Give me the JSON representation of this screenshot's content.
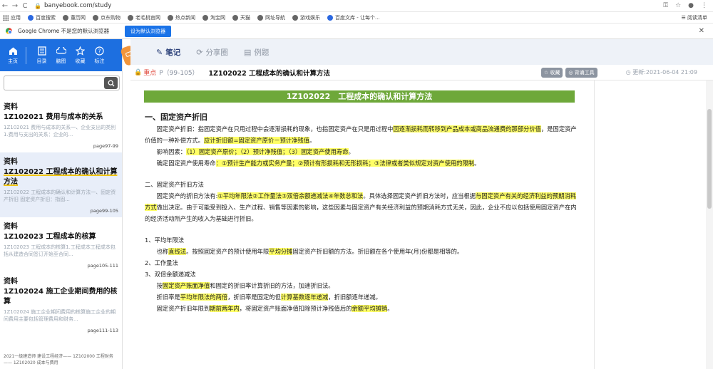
{
  "browser": {
    "url": "banyebook.com/study",
    "bookmarks": [
      "应用",
      "百度搜索",
      "董历网",
      "京东购物",
      "老毛桃官网",
      "热点新闻",
      "淘宝网",
      "天猫",
      "网址导航",
      "游戏娱乐",
      "百度文库 - 让每个..."
    ],
    "reading_list": "阅读清单",
    "infobar_text": "Google Chrome 不是您的默认浏览器",
    "infobar_button": "设为默认浏览器"
  },
  "sidebar": {
    "nav": [
      "主页",
      "目录",
      "脑图",
      "收藏",
      "标注"
    ],
    "search_placeholder": "",
    "cards": [
      {
        "category": "资料",
        "title": "1Z102021 费用与成本的关系",
        "snippet": "1Z102021 费用与成本的关系一、企业支出的类别1.费用与支出的关系：企业的...",
        "pages": "page97-99"
      },
      {
        "category": "资料",
        "title": "1Z102022 工程成本的确认和计算方法",
        "snippet": "1Z102022 工程成本的确认和计算方法一、固定资产折旧 固定资产折旧：指固...",
        "pages": "page99-105"
      },
      {
        "category": "资料",
        "title": "1Z102023 工程成本的核算",
        "snippet": "1Z102023 工程成本的核算1.工程成本工程成本包括从建造合同签订开始至合同...",
        "pages": "page105-111"
      },
      {
        "category": "资料",
        "title": "1Z102024 施工企业期间费用的核算",
        "snippet": "1Z102024 施工企业期间费用的核算施工企业的期间费用主要包括管理费用和财务...",
        "pages": "page111-113"
      }
    ],
    "footer": "2021一级建造师 建设工程经济—— 1Z102000 工程财务 —— 1Z102020 成本与费用"
  },
  "main": {
    "tabs": [
      "笔记",
      "分享圈",
      "例题"
    ],
    "key_label": "重点",
    "page_range": "P（99-105）",
    "title": "1Z102022 工程成本的确认和计算方法",
    "fav_button": "收藏",
    "tool_button": "背诵工具",
    "updated": "更新:2021-06-04 21:09"
  },
  "doc": {
    "banner": "1Z102022　工程成本的确认和计算方法",
    "s1_heading": "一、固定资产折旧",
    "p1a": "固定资产折旧：指固定资产在只用过程中会逐渐损耗的现象，也指固定资产在只是用过程中",
    "p1b": "因逐渐损耗而转移到产品成本或商品流通费的那部分价值",
    "p1c": "，是固定资产价值的一种补偿方式。",
    "p1d": "应计折旧额=固定资产原价－预计净残值",
    "p1e": "。",
    "p2a": "影响因素：",
    "p2b": "（1）固定资产原价；（2）预计净残值；（3）固定资产使用寿命",
    "p2c": "。",
    "p3a": "确定固定资产使用寿命",
    "p3b": "：①预计生产能力或实务产量；②预计有形损耗和无形损耗；③法律或者类似规定对资产使用的限制",
    "p3c": "。",
    "s2_heading": "二、固定资产折旧方法",
    "p4a": "固定资产的折旧方法有:",
    "p4b": "①平均年限法②工作量法③双倍余额递减法④年数总和法",
    "p4c": "。具体选择固定资产折旧方法时，应当根据",
    "p4d": "与固定资产有关的经济利益的预期消耗方式",
    "p4e": "做出决定。由于可能受到投入、生产过程、销售等因素的影响，这些因素与固定资产有关经济利益的预期消耗方式无关，因此，企业不应以包括使用固定资产在内的经济活动所产生的收入为基础进行折旧。",
    "m1": "1、平均年限法",
    "m1a": "也称",
    "m1b": "直线法",
    "m1c": "。按照固定资产的预计使用年限",
    "m1d": "平均分摊",
    "m1e": "固定资产折旧额的方法。折旧额在各个使用年(月)份都是相等的。",
    "m2": "2、工作量法",
    "m3": "3、双倍余额递减法",
    "m3a": "按",
    "m3b": "固定资产账面净值",
    "m3c": "和固定的折旧率计算折旧的方法，加速折旧法。",
    "m3d": "折旧率是",
    "m3e": "平均年限法的两倍",
    "m3f": "，折旧率是固定的但",
    "m3g": "计算基数逐年递减",
    "m3h": "，折旧额逐年递减。",
    "m3i": "固定资产折旧年限到",
    "m3j": "期前两年内",
    "m3k": "，将固定资产账面净值扣除预计净残值后的",
    "m3l": "余额平均摊销",
    "m3m": "。"
  }
}
